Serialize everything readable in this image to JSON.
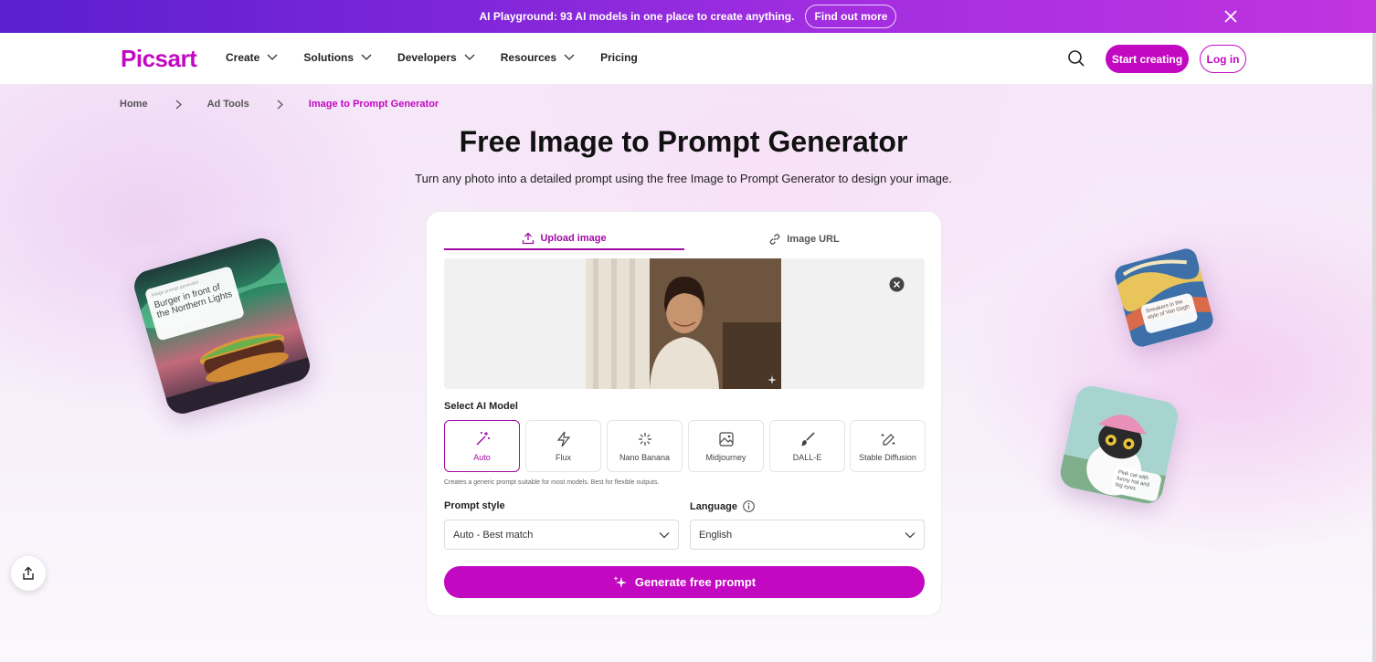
{
  "promo": {
    "text": "AI Playground: 93 AI models in one place to create anything.",
    "cta": "Find out more"
  },
  "nav": {
    "logo": "Picsart",
    "menu": [
      {
        "label": "Create",
        "has_dropdown": true
      },
      {
        "label": "Solutions",
        "has_dropdown": true
      },
      {
        "label": "Developers",
        "has_dropdown": true
      },
      {
        "label": "Resources",
        "has_dropdown": true
      },
      {
        "label": "Pricing",
        "has_dropdown": false
      }
    ],
    "start_label": "Start creating",
    "login_label": "Log in"
  },
  "breadcrumb": {
    "items": [
      "Home",
      "Ad Tools"
    ],
    "current": "Image to Prompt Generator"
  },
  "hero": {
    "title": "Free Image to Prompt Generator",
    "subtitle": "Turn any photo into a detailed prompt using the free Image to Prompt Generator to design your image."
  },
  "card": {
    "tabs": [
      {
        "label": "Upload image",
        "active": true,
        "icon": "upload-icon"
      },
      {
        "label": "Image URL",
        "active": false,
        "icon": "link-icon"
      }
    ],
    "model_section_label": "Select AI Model",
    "models": [
      {
        "label": "Auto",
        "icon": "magic-wand-icon",
        "active": true
      },
      {
        "label": "Flux",
        "icon": "lightning-icon",
        "active": false
      },
      {
        "label": "Nano Banana",
        "icon": "sparkle-burst-icon",
        "active": false
      },
      {
        "label": "Midjourney",
        "icon": "image-icon",
        "active": false
      },
      {
        "label": "DALL-E",
        "icon": "brush-icon",
        "active": false
      },
      {
        "label": "Stable Diffusion",
        "icon": "pencil-sparkle-icon",
        "active": false
      }
    ],
    "model_hint": "Creates a generic prompt suitable for most models. Best for flexible outputs.",
    "prompt_style_label": "Prompt style",
    "prompt_style_value": "Auto - Best match",
    "language_label": "Language",
    "language_value": "English",
    "generate_label": "Generate free prompt"
  },
  "floating": {
    "burger_header": "Image prompt generator",
    "burger_text": "Burger in front of the Northern Lights",
    "sneakers_text": "Sneakers in the style of Van Gogh",
    "cat_text": "Pink cat with funny hat and big eyes"
  },
  "colors": {
    "brand": "#c209c1",
    "accent_tab": "#a10aa6"
  }
}
